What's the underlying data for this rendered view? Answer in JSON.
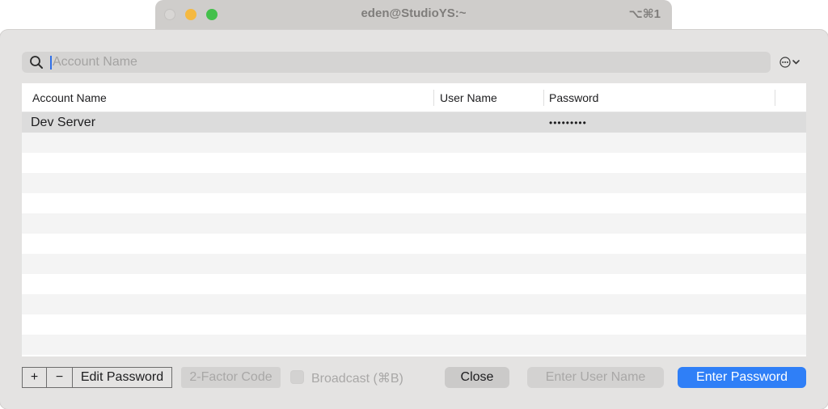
{
  "background_window": {
    "title": "eden@StudioYS:~",
    "shortcut": "⌥⌘1"
  },
  "search": {
    "placeholder": "Account Name",
    "value": ""
  },
  "table": {
    "columns": [
      "Account Name",
      "User Name",
      "Password"
    ],
    "rows": [
      {
        "account": "Dev Server",
        "user": "",
        "password": "•••••••••"
      }
    ]
  },
  "toolbar": {
    "add_label": "+",
    "remove_label": "−",
    "edit_password_label": "Edit Password",
    "two_factor_label": "2-Factor Code",
    "broadcast_label": "Broadcast (⌘B)",
    "close_label": "Close",
    "enter_user_label": "Enter User Name",
    "enter_password_label": "Enter Password"
  },
  "colors": {
    "accent": "#2f7ff7",
    "sheet_bg": "#e4e3e2",
    "selected_row": "#dcdcdc"
  },
  "icons": [
    "search-icon",
    "more-options-icon",
    "chevron-down-icon"
  ]
}
